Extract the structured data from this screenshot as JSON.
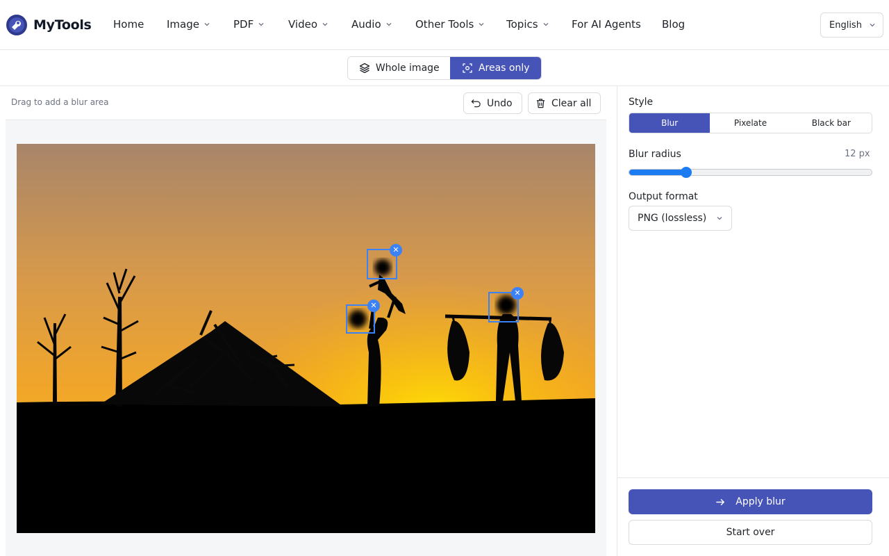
{
  "header": {
    "brand": "MyTools",
    "nav": [
      {
        "label": "Home",
        "has_menu": false
      },
      {
        "label": "Image",
        "has_menu": true
      },
      {
        "label": "PDF",
        "has_menu": true
      },
      {
        "label": "Video",
        "has_menu": true
      },
      {
        "label": "Audio",
        "has_menu": true
      },
      {
        "label": "Other Tools",
        "has_menu": true
      },
      {
        "label": "Topics",
        "has_menu": true
      },
      {
        "label": "For AI Agents",
        "has_menu": false
      },
      {
        "label": "Blog",
        "has_menu": false
      }
    ],
    "language": "English"
  },
  "mode": {
    "options": [
      "Whole image",
      "Areas only"
    ],
    "selected": "Areas only"
  },
  "workspace": {
    "hint": "Drag to add a blur area",
    "undo_label": "Undo",
    "clear_label": "Clear all",
    "blur_area_count": 3
  },
  "panel": {
    "style_label": "Style",
    "style_options": [
      "Blur",
      "Pixelate",
      "Black bar"
    ],
    "style_selected": "Blur",
    "radius_label": "Blur radius",
    "radius_value": "12 px",
    "radius_fraction": 0.235,
    "format_label": "Output format",
    "format_value": "PNG (lossless)",
    "apply_label": "Apply blur",
    "start_over_label": "Start over"
  },
  "colors": {
    "accent": "#4654b8",
    "slider": "#1d7cf2",
    "blur_box": "#3b82f6"
  },
  "icons": [
    "logo-icon",
    "chevron-down-icon",
    "layers-icon",
    "focus-scan-icon",
    "undo-icon",
    "trash-icon",
    "close-icon",
    "arrow-right-icon"
  ]
}
